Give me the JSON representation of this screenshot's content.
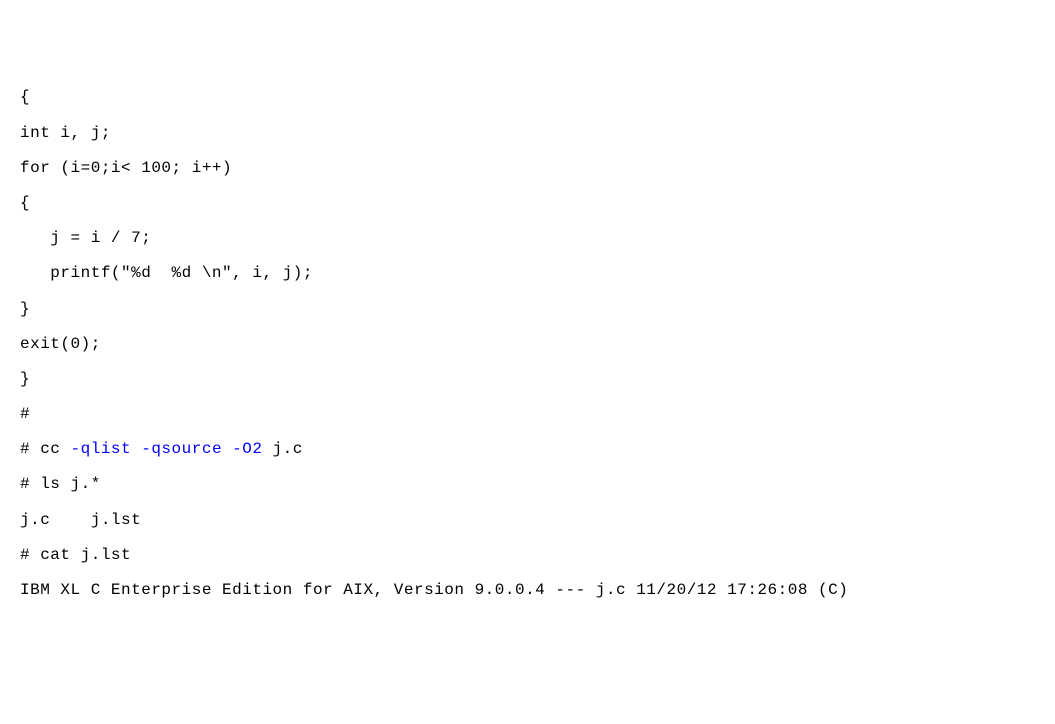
{
  "lines": {
    "l1": "{",
    "l2": "",
    "l3": "int i, j;",
    "l4": "",
    "l5": "for (i=0;i< 100; i++)",
    "l6": "{",
    "l7": "   j = i / 7;",
    "l8": "   printf(\"%d  %d \\n\", i, j);",
    "l9": "}",
    "l10": "",
    "l11": "exit(0);",
    "l12": "}",
    "l13": "#",
    "l14_prefix": "# cc ",
    "l14_hl": "-qlist -qsource -O2",
    "l14_suffix": " j.c",
    "l15": "# ls j.*",
    "l16": "j.c    j.lst",
    "l17": "# cat j.lst",
    "l18": "IBM XL C Enterprise Edition for AIX, Version 9.0.0.4 --- j.c 11/20/12 17:26:08 (C)"
  }
}
